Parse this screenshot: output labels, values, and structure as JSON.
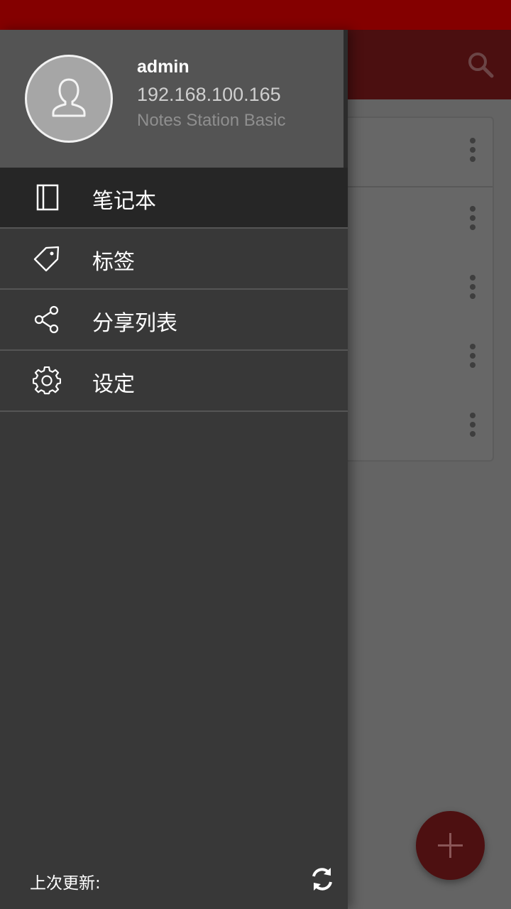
{
  "colors": {
    "status_bar": "#840000",
    "toolbar": "#4b0f10",
    "drawer_bg": "#383838",
    "drawer_header_bg": "#545454",
    "active_item_bg": "#262626",
    "fab": "#4d1011"
  },
  "toolbar": {
    "search_icon": "search-icon"
  },
  "drawer": {
    "user": {
      "name": "admin",
      "host": "192.168.100.165",
      "app": "Notes Station Basic",
      "avatar_icon": "user-icon"
    },
    "menu": [
      {
        "label": "笔记本",
        "icon": "notebook-icon",
        "active": true
      },
      {
        "label": "标签",
        "icon": "tag-icon",
        "active": false
      },
      {
        "label": "分享列表",
        "icon": "share-icon",
        "active": false
      },
      {
        "label": "设定",
        "icon": "gear-icon",
        "active": false
      }
    ],
    "footer": {
      "last_update_label": "上次更新:",
      "refresh_icon": "refresh-icon"
    }
  },
  "background_list": {
    "row_count": 5,
    "row_icon": "more-vert-icon"
  },
  "fab": {
    "icon": "plus-icon"
  }
}
